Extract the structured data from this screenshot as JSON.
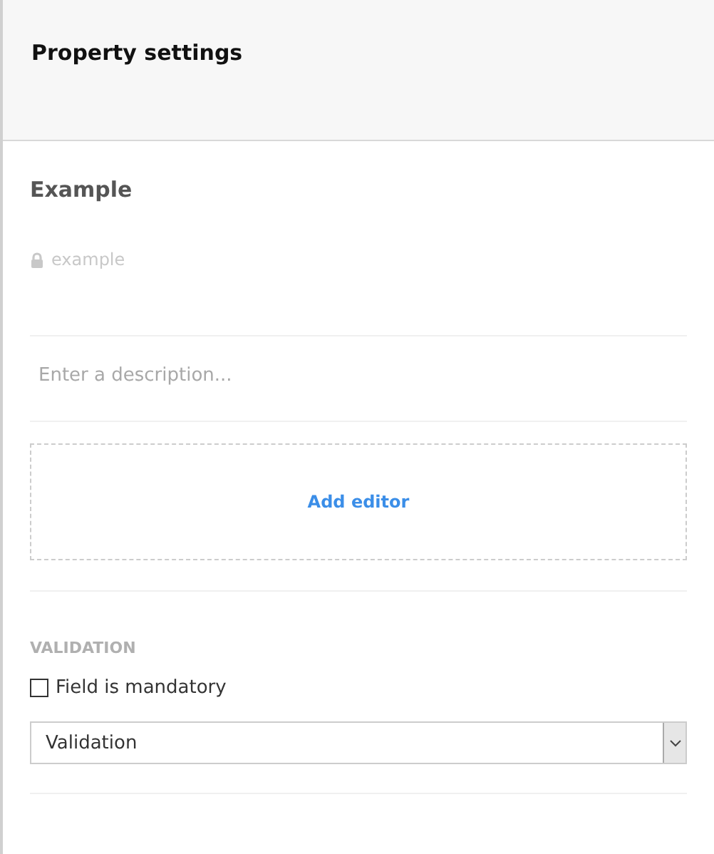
{
  "header": {
    "title": "Property settings"
  },
  "property": {
    "name": "Example",
    "alias": "example",
    "alias_locked": true
  },
  "description": {
    "placeholder": "Enter a description..."
  },
  "editor": {
    "add_label": "Add editor"
  },
  "validation": {
    "heading": "VALIDATION",
    "mandatory": {
      "label": "Field is mandatory",
      "checked": false
    },
    "select": {
      "value": "Validation"
    }
  }
}
